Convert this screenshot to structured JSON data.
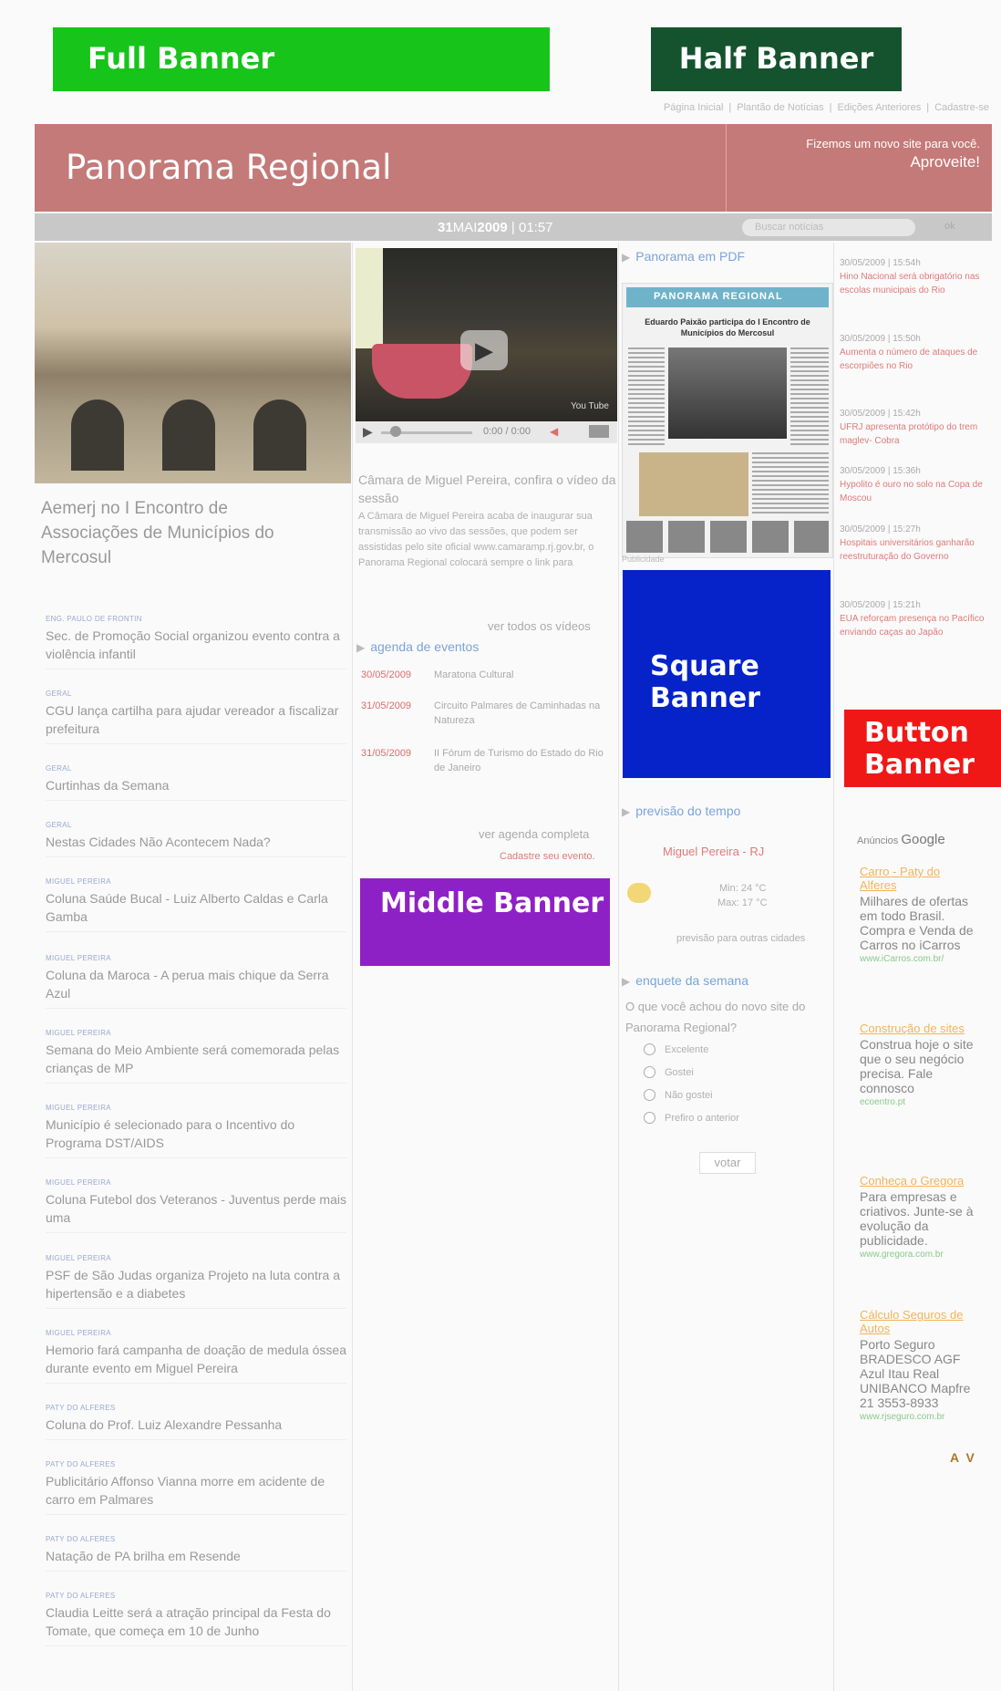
{
  "banners": {
    "full": "Full Banner",
    "half": "Half Banner",
    "square": "Square Banner",
    "middle": "Middle Banner",
    "button": "Button Banner"
  },
  "nav": {
    "links": [
      "Página Inicial",
      "Plantão de Notícias",
      "Edições Anteriores",
      "Cadastre-se"
    ],
    "separator": "|"
  },
  "header": {
    "title": "Panorama Regional",
    "promo_line1": "Fizemos um novo site para você.",
    "promo_line2": "Aproveite!",
    "background_color": "#c47a78"
  },
  "datebar": {
    "day": "31",
    "month": "MAI",
    "year": "2009",
    "separator": "|",
    "time": "01:57",
    "search_placeholder": "Buscar notícias",
    "search_button": "ok"
  },
  "lead": {
    "title": "Aemerj no I Encontro de Associações de Municípios do Mercosul"
  },
  "news": [
    {
      "category": "ENG. PAULO DE FRONTIN",
      "headline": "Sec. de Promoção Social organizou evento contra a violência infantil"
    },
    {
      "category": "GERAL",
      "headline": "CGU lança cartilha para ajudar vereador a fiscalizar prefeitura"
    },
    {
      "category": "GERAL",
      "headline": "Curtinhas da Semana"
    },
    {
      "category": "GERAL",
      "headline": "Nestas Cidades Não Acontecem Nada?"
    },
    {
      "category": "MIGUEL PEREIRA",
      "headline": "Coluna Saúde Bucal - Luiz Alberto Caldas e Carla Gamba"
    },
    {
      "category": "MIGUEL PEREIRA",
      "headline": "Coluna da Maroca - A perua mais chique da Serra Azul"
    },
    {
      "category": "MIGUEL PEREIRA",
      "headline": "Semana do Meio Ambiente será comemorada pelas crianças de MP"
    },
    {
      "category": "MIGUEL PEREIRA",
      "headline": "Município é selecionado para o Incentivo do Programa DST/AIDS"
    },
    {
      "category": "MIGUEL PEREIRA",
      "headline": "Coluna Futebol dos Veteranos - Juventus perde mais uma"
    },
    {
      "category": "MIGUEL PEREIRA",
      "headline": "PSF de São Judas organiza Projeto na luta contra a hipertensão e a diabetes"
    },
    {
      "category": "MIGUEL PEREIRA",
      "headline": "Hemorio fará campanha de doação de medula óssea durante evento em Miguel Pereira"
    },
    {
      "category": "PATY DO ALFERES",
      "headline": "Coluna do Prof. Luiz Alexandre Pessanha"
    },
    {
      "category": "PATY DO ALFERES",
      "headline": "Publicitário Affonso Vianna morre em acidente de carro em Palmares"
    },
    {
      "category": "PATY DO ALFERES",
      "headline": "Natação de PA brilha em Resende"
    },
    {
      "category": "PATY DO ALFERES",
      "headline": "Claudia Leitte será a atração principal da Festa do Tomate, que começa em 10 de Junho"
    }
  ],
  "video": {
    "time": "0:00 / 0:00",
    "youtube_label": "You Tube",
    "caption": "Câmara de Miguel Pereira, confira o vídeo da sessão",
    "description": "A Câmara de Miguel Pereira acaba de inaugurar sua transmissão ao vivo das sessões, que podem ser assistidas pelo site oficial www.camaramp.rj.gov.br, o Panorama Regional colocará sempre o link para",
    "all_videos": "ver todos os vídeos"
  },
  "agenda": {
    "title": "agenda de eventos",
    "events": [
      {
        "date": "30/05/2009",
        "text": "Maratona Cultural"
      },
      {
        "date": "31/05/2009",
        "text": "Circuito Palmares de Caminhadas na Natureza"
      },
      {
        "date": "31/05/2009",
        "text": "II Fórum de Turismo do Estado do Rio de Janeiro"
      }
    ],
    "full_link": "ver agenda completa",
    "register_link": "Cadastre seu evento."
  },
  "pdf": {
    "title": "Panorama em PDF",
    "masthead": "PANORAMA REGIONAL",
    "headline": "Eduardo Paixão participa do I Encontro de Municípios do Mercosul",
    "publicity": "Publicidade"
  },
  "weather": {
    "title": "previsão do tempo",
    "city": "Miguel Pereira - RJ",
    "min": "Min: 24 °C",
    "max": "Max: 17 °C",
    "other_cities": "previsão para outras cidades"
  },
  "poll": {
    "title": "enquete da semana",
    "question": "O que você achou do novo site do Panorama Regional?",
    "options": [
      "Excelente",
      "Gostei",
      "Não gostei",
      "Prefiro o anterior"
    ],
    "vote": "votar"
  },
  "plantao": [
    {
      "time": "30/05/2009 | 15:54h",
      "text": "Hino Nacional será obrigatório nas escolas municipais do Rio"
    },
    {
      "time": "30/05/2009 | 15:50h",
      "text": "Aumenta o número de ataques de escorpiões no Rio"
    },
    {
      "time": "30/05/2009 | 15:42h",
      "text": "UFRJ apresenta protótipo do trem maglev- Cobra"
    },
    {
      "time": "30/05/2009 | 15:36h",
      "text": "Hypolito é ouro no solo na Copa de Moscou"
    },
    {
      "time": "30/05/2009 | 15:27h",
      "text": "Hospitais universitários ganharão reestruturação do Governo"
    },
    {
      "time": "30/05/2009 | 15:21h",
      "text": "EUA reforçam presença no Pacífico enviando caças ao Japão"
    }
  ],
  "ads": {
    "label": "Anúncios",
    "brand": "Google",
    "items": [
      {
        "title": "Carro - Paty do Alferes",
        "text": "Milhares de ofertas em todo Brasil. Compra e Venda de Carros no iCarros",
        "url": "www.iCarros.com.br/"
      },
      {
        "title": "Construção de sites",
        "text": "Construa hoje o site que o seu negócio precisa. Fale connosco",
        "url": "ecoentro.pt"
      },
      {
        "title": "Conheça o Gregora",
        "text": "Para empresas e criativos. Junte-se à evolução da publicidade.",
        "url": "www.gregora.com.br"
      },
      {
        "title": "Cálculo Seguros de Autos",
        "text": "Porto Seguro BRADESCO AGF Azul Itau Real UNIBANCO Mapfre 21 3553-8933",
        "url": "www.rjseguro.com.br"
      }
    ],
    "nav": "A V"
  }
}
